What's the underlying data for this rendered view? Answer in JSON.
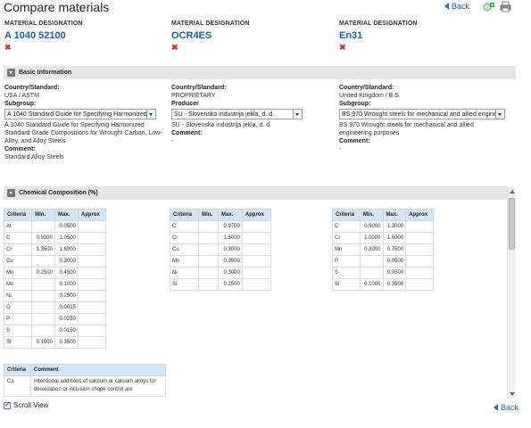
{
  "header": {
    "title": "Compare materials",
    "back_label": "Back",
    "icons": [
      "add-material-icon",
      "print-icon"
    ]
  },
  "materials": [
    {
      "label": "MATERIAL DESIGNATION",
      "name": "A 1040 52100",
      "remove": "✖"
    },
    {
      "label": "MATERIAL DESIGNATION",
      "name": "OCR4ES",
      "remove": "✖"
    },
    {
      "label": "MATERIAL DESIGNATION",
      "name": "En31",
      "remove": "✖"
    }
  ],
  "basic_info": {
    "title": "Basic Information",
    "columns": [
      {
        "country_label": "Country/Standard:",
        "country_value": "USA / ASTM",
        "sub_label": "Subgroup:",
        "select_value": "A 1040 Standard Guide for Specifying Harmonized",
        "sub_value": "A 1040 Standard Guide for Specifying Harmonized Standard Grade Compositions for Wrought Carbon, Low-Alloy, and Alloy Steels",
        "comment_label": "Comment:",
        "comment_value": "Standard Alloy Steels"
      },
      {
        "country_label": "Country/Standard:",
        "country_value": "PROPRIETARY",
        "sub_label": "Producer",
        "select_value": "SU - Slovenska industrija jekla, d. d.",
        "sub_value": "SU - Slovenska industrija jekla, d. d.",
        "comment_label": "Comment:",
        "comment_value": "-"
      },
      {
        "country_label": "Country/Standard:",
        "country_value": "United Kingdom / B.S.",
        "sub_label": "Subgroup:",
        "select_value": "BS 970 Wrought steels for mechanical and allied engineering purposes",
        "sub_value": "BS 970 Wrought steels for mechanical and allied engineering purposes",
        "comment_label": "Comment:",
        "comment_value": "-"
      }
    ]
  },
  "chemical": {
    "title": "Chemical Composition (%)",
    "headers": [
      "Criteria",
      "Min.",
      "Max.",
      "Approx"
    ],
    "tables": [
      [
        [
          "Al",
          "",
          "0.0500",
          ""
        ],
        [
          "C",
          "0.9300",
          "1.0500",
          ""
        ],
        [
          "Cr",
          "1.3500",
          "1.6000",
          ""
        ],
        [
          "Cu",
          "",
          "0.3000",
          ""
        ],
        [
          "Mn",
          "0.2500",
          "0.4500",
          ""
        ],
        [
          "Mo",
          "",
          "0.1000",
          ""
        ],
        [
          "Ni",
          "",
          "0.2500",
          ""
        ],
        [
          "O",
          "",
          "0.0015",
          ""
        ],
        [
          "P",
          "",
          "0.0250",
          ""
        ],
        [
          "S",
          "",
          "0.0150",
          ""
        ],
        [
          "Si",
          "0.1500",
          "0.3500",
          ""
        ]
      ],
      [
        [
          "C",
          "",
          "0.9700",
          ""
        ],
        [
          "Cr",
          "",
          "1.5000",
          ""
        ],
        [
          "Cu",
          "",
          "0.3000",
          ""
        ],
        [
          "Mn",
          "",
          "0.3500",
          ""
        ],
        [
          "Ni",
          "",
          "0.3000",
          ""
        ],
        [
          "Si",
          "",
          "0.2500",
          ""
        ]
      ],
      [
        [
          "C",
          "0.9000",
          "1.2000",
          ""
        ],
        [
          "Cr",
          "1.0000",
          "1.6000",
          ""
        ],
        [
          "Mn",
          "0.3000",
          "0.7500",
          ""
        ],
        [
          "P",
          "",
          "0.0500",
          ""
        ],
        [
          "S",
          "",
          "0.0500",
          ""
        ],
        [
          "Si",
          "0.1000",
          "0.3500",
          ""
        ]
      ]
    ],
    "comment_headers": [
      "Criteria",
      "Comment"
    ],
    "comment_rows": [
      [
        "Ca",
        "Intentional additions of calcium or calcium alloys for deoxidation or inclusion shape control are"
      ]
    ]
  },
  "footer": {
    "scroll_view_label": "Scroll View",
    "back_label": "Back"
  }
}
